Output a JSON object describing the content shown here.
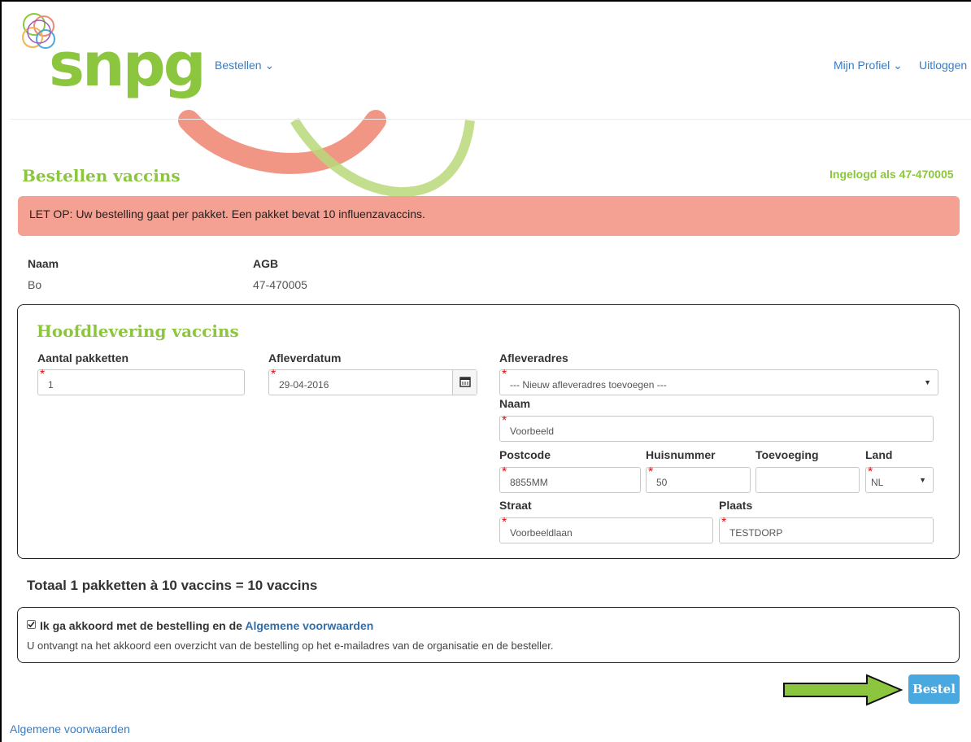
{
  "header": {
    "logo_text": "snpg",
    "nav_bestellen": "Bestellen ⌄",
    "nav_profiel": "Mijn Profiel ⌄",
    "nav_uitloggen": "Uitloggen"
  },
  "page": {
    "title": "Bestellen vaccins",
    "logged_in": "Ingelogd als 47-470005",
    "alert": "LET OP: Uw bestelling gaat per pakket. Een pakket bevat 10 influenzavaccins."
  },
  "account": {
    "naam_label": "Naam",
    "naam_value": "Bo",
    "agb_label": "AGB",
    "agb_value": "47-470005"
  },
  "delivery": {
    "title": "Hoofdlevering vaccins",
    "aantal_label": "Aantal pakketten",
    "aantal_value": "1",
    "datum_label": "Afleverdatum",
    "datum_value": "29-04-2016",
    "adres_label": "Afleveradres",
    "adres_value": "--- Nieuw afleveradres toevoegen ---",
    "naam_label": "Naam",
    "naam_value": "Voorbeeld",
    "postcode_label": "Postcode",
    "postcode_value": "8855MM",
    "huisnummer_label": "Huisnummer",
    "huisnummer_value": "50",
    "toevoeging_label": "Toevoeging",
    "toevoeging_value": "",
    "land_label": "Land",
    "land_value": "NL",
    "straat_label": "Straat",
    "straat_value": "Voorbeeldlaan",
    "plaats_label": "Plaats",
    "plaats_value": "TESTDORP"
  },
  "total": "Totaal 1 pakketten à 10 vaccins = 10 vaccins",
  "agreement": {
    "checked": true,
    "label_prefix": "Ik ga akkoord met de bestelling en de",
    "label_link": "Algemene voorwaarden",
    "note": "U ontvangt na het akkoord een overzicht van de bestelling op het e-mailadres van de organisatie en de besteller."
  },
  "actions": {
    "bestel_label": "Bestel"
  },
  "footer": {
    "link": "Algemene voorwaarden"
  },
  "colors": {
    "brand_green": "#8cc63f",
    "alert_bg": "#f4a092",
    "link": "#3a7bbf",
    "button": "#4aa8e0",
    "arrow": "#8cc63f"
  },
  "icons": {
    "calendar": "calendar-icon",
    "dropdown": "chevron-down-icon",
    "checkbox": "checkbox-checked-icon",
    "arrow": "arrow-right-icon"
  }
}
